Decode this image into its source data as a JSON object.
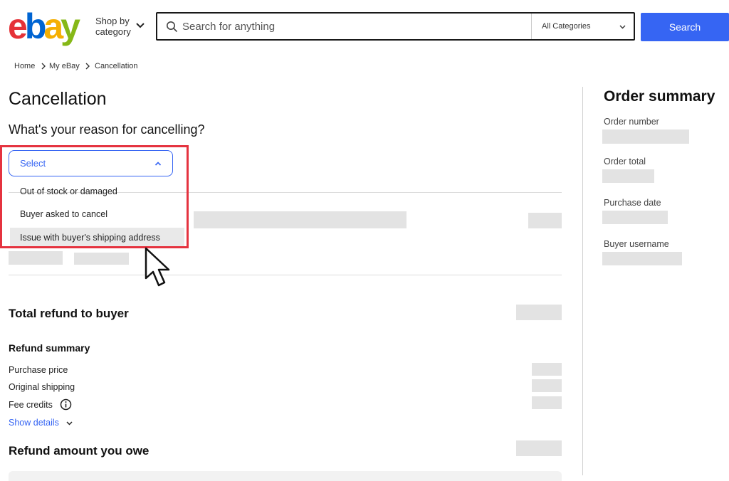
{
  "header": {
    "logo": {
      "e": "e",
      "b": "b",
      "a": "a",
      "y": "y",
      "colors": {
        "e": "#e53238",
        "b": "#0064d2",
        "a": "#f5af02",
        "y": "#86b817"
      }
    },
    "shop_by_line1": "Shop by",
    "shop_by_line2": "category",
    "search_placeholder": "Search for anything",
    "category_label": "All Categories",
    "search_button": "Search"
  },
  "breadcrumb": [
    "Home",
    "My eBay",
    "Cancellation"
  ],
  "main": {
    "title": "Cancellation",
    "question": "What's your reason for cancelling?",
    "select": {
      "label": "Select",
      "options": [
        "Out of stock or damaged",
        "Buyer asked to cancel",
        "Issue with buyer's shipping address"
      ],
      "highlighted_index": 2
    },
    "total_refund_label": "Total refund to buyer",
    "refund_summary": {
      "heading": "Refund summary",
      "rows": [
        "Purchase price",
        "Original shipping",
        "Fee credits"
      ],
      "show_details": "Show details"
    },
    "refund_owe_label": "Refund amount you owe"
  },
  "order_summary": {
    "title": "Order summary",
    "fields": [
      "Order number",
      "Order total",
      "Purchase date",
      "Buyer username"
    ]
  },
  "colors": {
    "accent": "#3665f3",
    "highlight_box": "#e5333f"
  }
}
